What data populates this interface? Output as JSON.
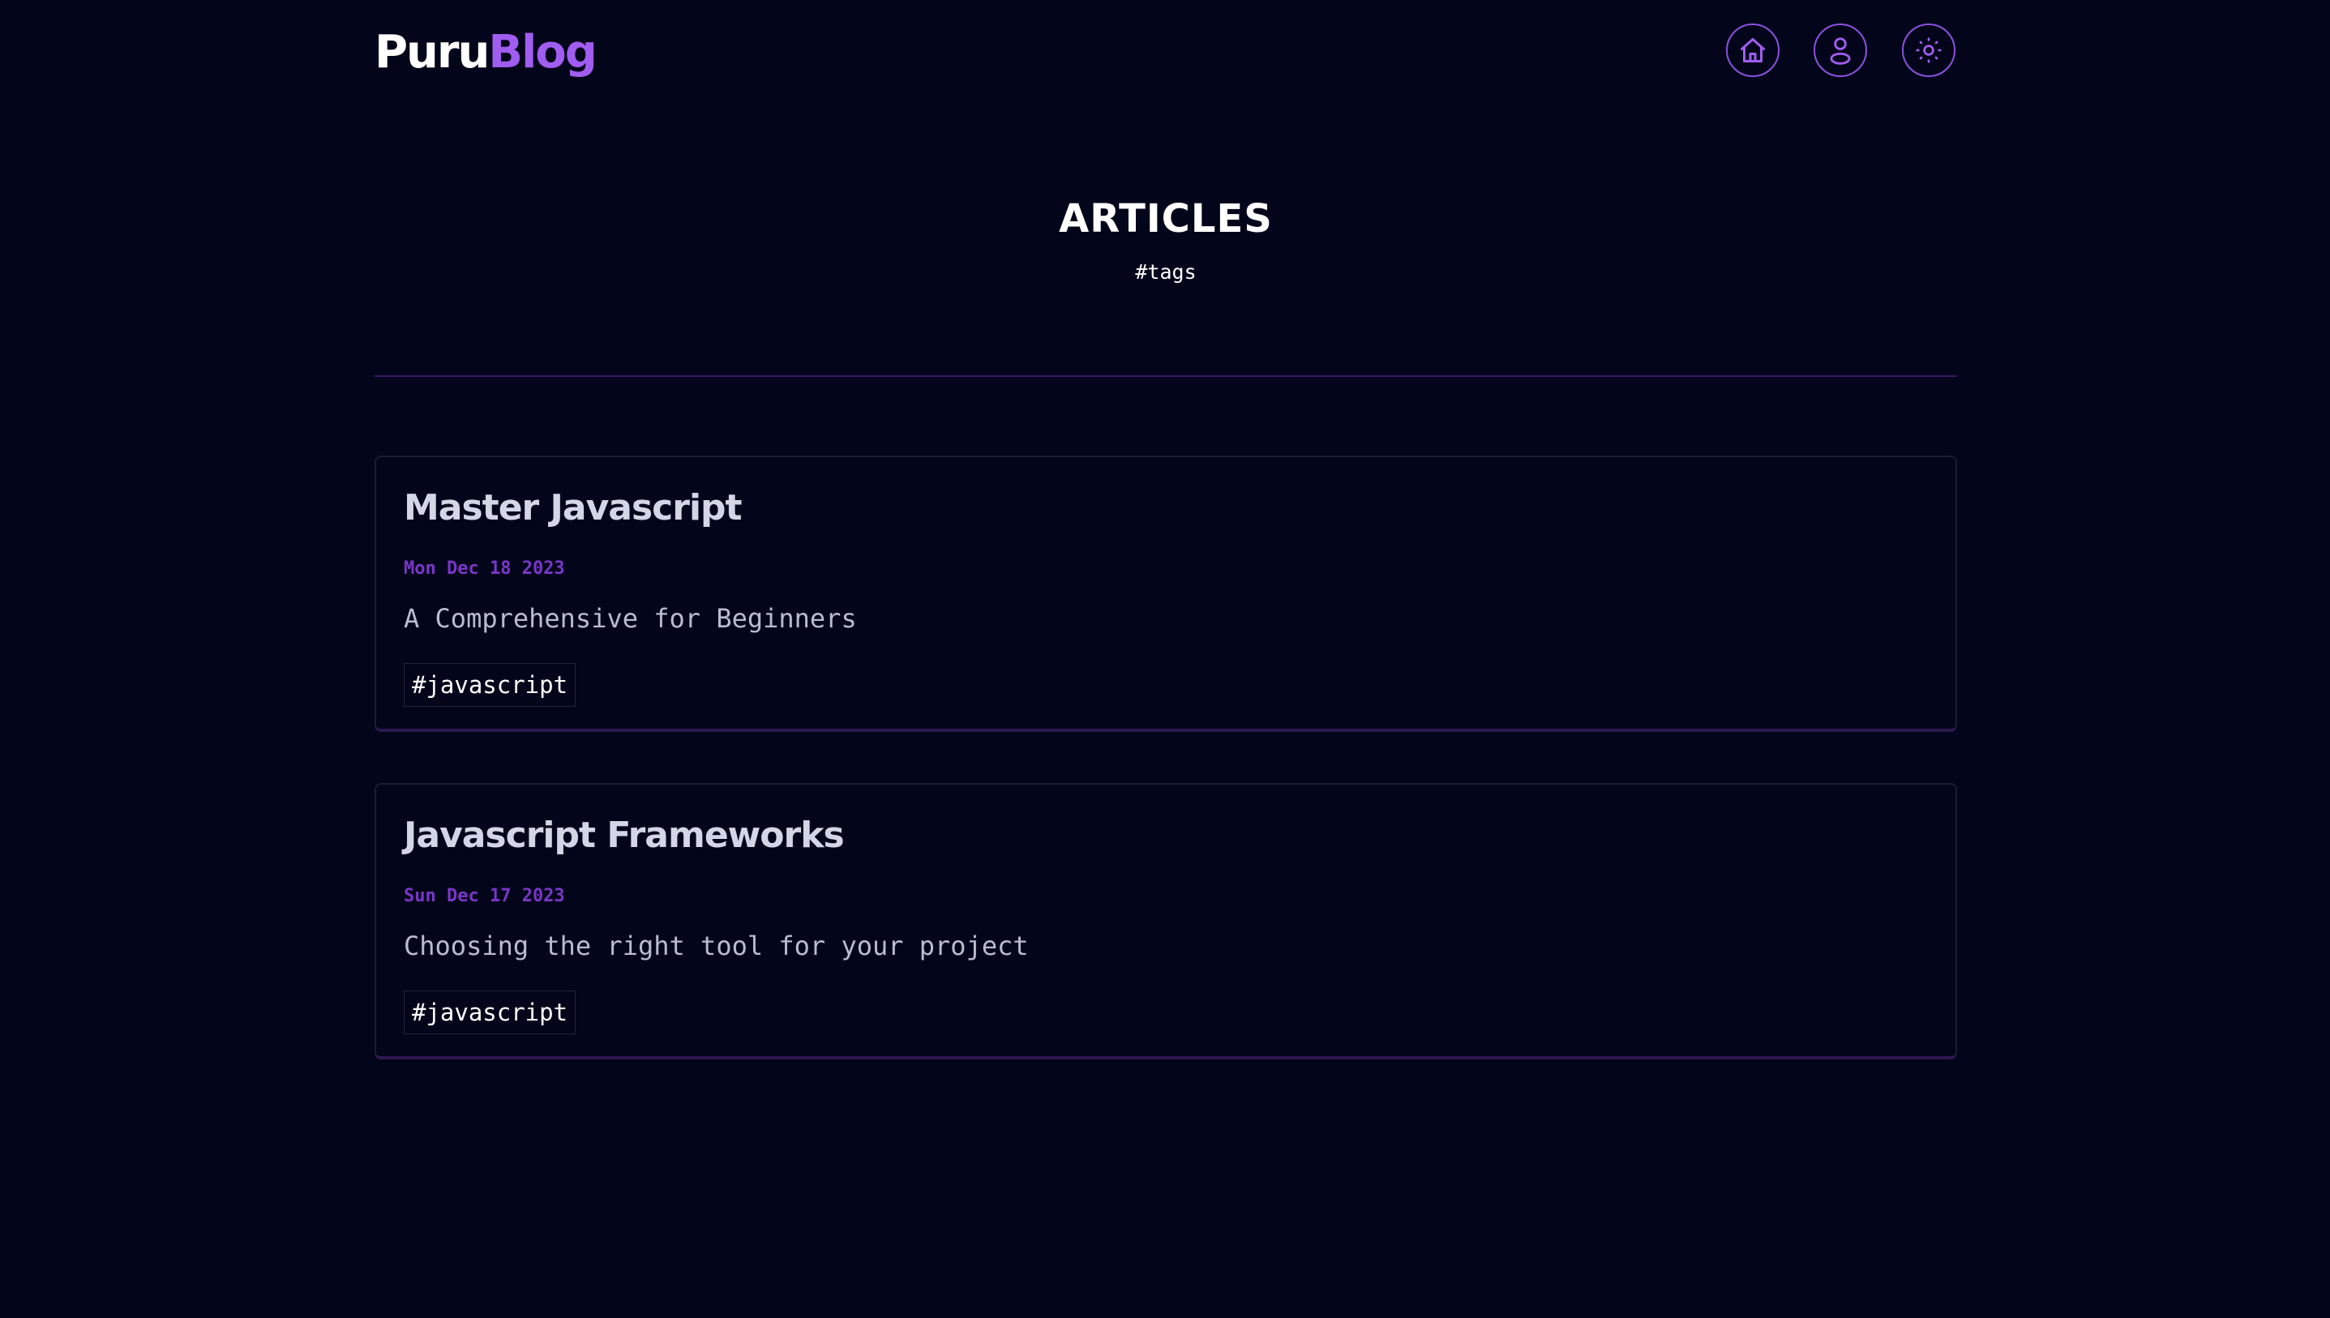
{
  "header": {
    "logo_part1": "Puru",
    "logo_part2": "Blog",
    "nav": [
      {
        "name": "home",
        "icon": "home-icon"
      },
      {
        "name": "about",
        "icon": "user-icon"
      },
      {
        "name": "theme-toggle",
        "icon": "sun-icon"
      }
    ]
  },
  "main": {
    "title": "ARTICLES",
    "tags_link": "#tags"
  },
  "articles": [
    {
      "title": "Master Javascript",
      "date": "Mon Dec 18 2023",
      "description": "A Comprehensive for Beginners",
      "tag": "#javascript"
    },
    {
      "title": "Javascript Frameworks",
      "date": "Sun Dec 17 2023",
      "description": "Choosing the right tool for your project",
      "tag": "#javascript"
    }
  ],
  "colors": {
    "background": "#03061a",
    "accent": "#a15cf0",
    "date": "#7a36c8",
    "title_text": "#d4d6e8",
    "divider": "#3b1668"
  }
}
